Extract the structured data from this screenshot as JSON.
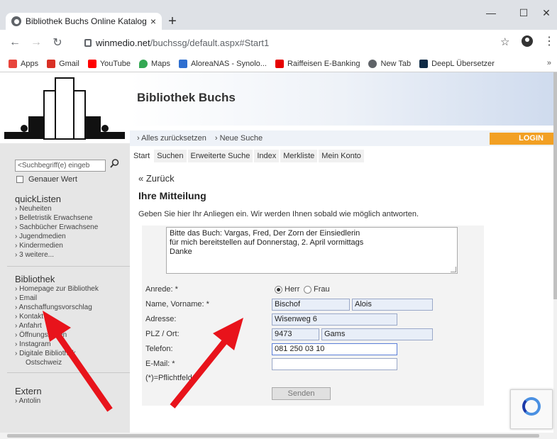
{
  "browser": {
    "tab_title": "Bibliothek Buchs Online Katalog",
    "tab_close": "×",
    "new_tab": "+",
    "url_host": "winmedio.net",
    "url_path": "/buchssg/default.aspx#Start1",
    "bookmarks": [
      {
        "label": "Apps",
        "icon": "apps-grid-icon",
        "color": "#e8453c"
      },
      {
        "label": "Gmail",
        "icon": "gmail-icon",
        "color": "#d93025"
      },
      {
        "label": "YouTube",
        "icon": "youtube-icon",
        "color": "#ff0000"
      },
      {
        "label": "Maps",
        "icon": "maps-pin-icon",
        "color": "#34a853"
      },
      {
        "label": "AloreaNAS - Synolo...",
        "icon": "synology-icon",
        "color": "#2f6fd0"
      },
      {
        "label": "Raiffeisen E-Banking",
        "icon": "raiffeisen-icon",
        "color": "#e60000"
      },
      {
        "label": "New Tab",
        "icon": "globe-icon",
        "color": "#5f6368"
      },
      {
        "label": "DeepL Übersetzer",
        "icon": "deepl-icon",
        "color": "#0f2b46"
      }
    ],
    "bookmarks_more": "»"
  },
  "header": {
    "title": "Bibliothek Buchs",
    "reset": "Alles zurücksetzen",
    "new_search": "Neue Suche",
    "login": "LOGIN"
  },
  "tabs": [
    "Start",
    "Suchen",
    "Erweiterte Suche",
    "Index",
    "Merkliste",
    "Mein Konto"
  ],
  "sidebar": {
    "search_placeholder": "<Suchbegriff(e) eingeb",
    "exact_value": "Genauer Wert",
    "quicklisten_title": "quickListen",
    "quicklisten": [
      "Neuheiten",
      "Belletristik Erwachsene",
      "Sachbücher Erwachsene",
      "Jugendmedien",
      "Kindermedien",
      "3 weitere..."
    ],
    "bibliothek_title": "Bibliothek",
    "bibliothek": [
      "Homepage zur Bibliothek",
      "Email",
      "Anschaffungsvorschlag",
      "Kontakt",
      "Anfahrt",
      "Öffnungszeiten",
      "Instagram",
      "Digitale Bibliothek",
      "Ostschweiz"
    ],
    "extern_title": "Extern",
    "extern": [
      "Antolin"
    ]
  },
  "form": {
    "back": "« Zurück",
    "title": "Ihre Mitteilung",
    "intro": "Geben Sie hier Ihr Anliegen ein. Wir werden Ihnen sobald wie möglich antworten.",
    "message_lines": [
      "Bitte das Buch: Vargas, Fred, Der Zorn der Einsiedlerin",
      "für mich bereitstellen auf Donnerstag, 2. April vormittags",
      "Danke"
    ],
    "labels": {
      "anrede": "Anrede: *",
      "name": "Name, Vorname: *",
      "adresse": "Adresse:",
      "plz": "PLZ / Ort:",
      "telefon": "Telefon:",
      "email": "E-Mail: *",
      "required": "(*)=Pflichtfeld"
    },
    "anrede_options": [
      "Herr",
      "Frau"
    ],
    "anrede_selected": "Herr",
    "name": "Bischof",
    "vorname": "Alois",
    "adresse": "Wisenweg 6",
    "plz": "9473",
    "ort": "Gams",
    "telefon": "081 250 03 10",
    "email": "",
    "submit": "Senden"
  },
  "colors": {
    "login_bg": "#f2a023",
    "arrow": "#e8131b",
    "field_bg": "#e8eef8"
  }
}
